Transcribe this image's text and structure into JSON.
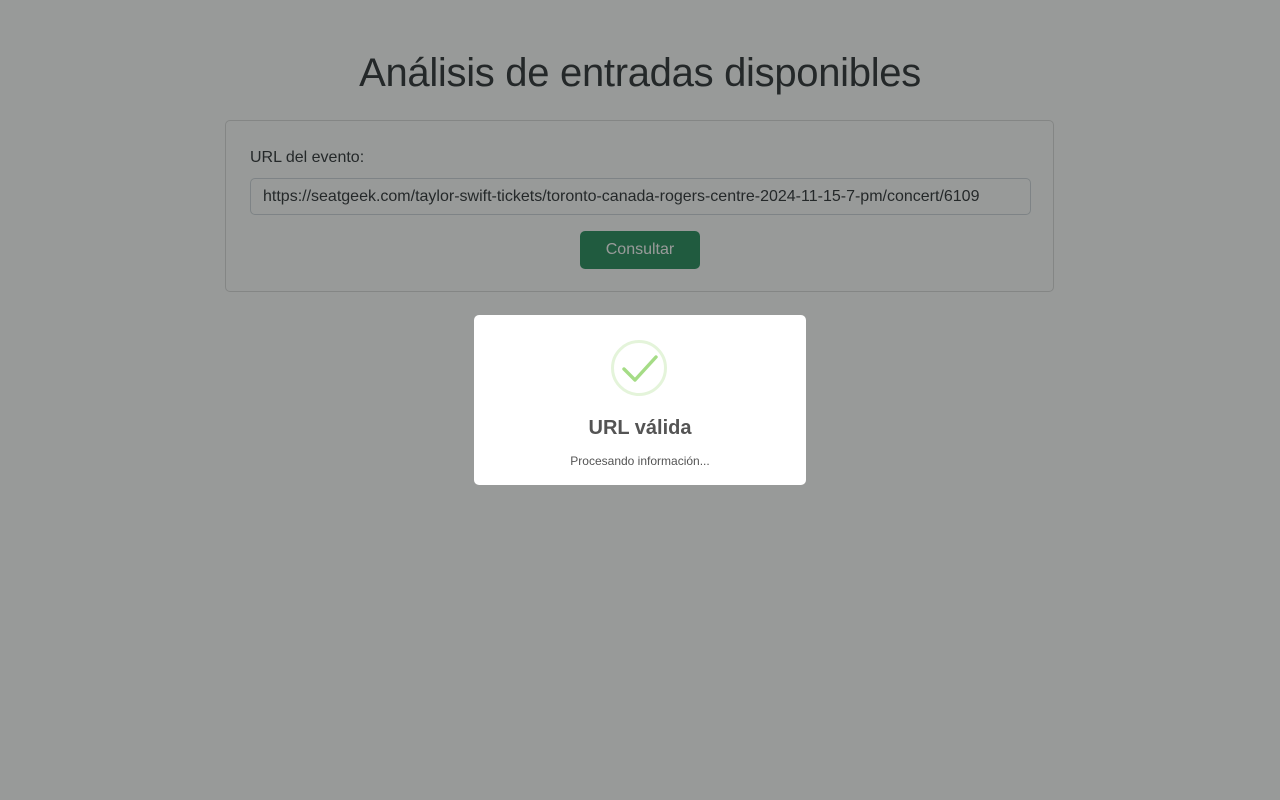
{
  "page": {
    "title": "Análisis de entradas disponibles"
  },
  "form": {
    "label": "URL del evento:",
    "url_value": "https://seatgeek.com/taylor-swift-tickets/toronto-canada-rogers-centre-2024-11-15-7-pm/concert/6109",
    "submit_label": "Consultar",
    "button_color": "#198754"
  },
  "modal": {
    "icon": "success-checkmark-icon",
    "icon_color": "#a5dc86",
    "title": "URL válida",
    "text": "Procesando información..."
  }
}
